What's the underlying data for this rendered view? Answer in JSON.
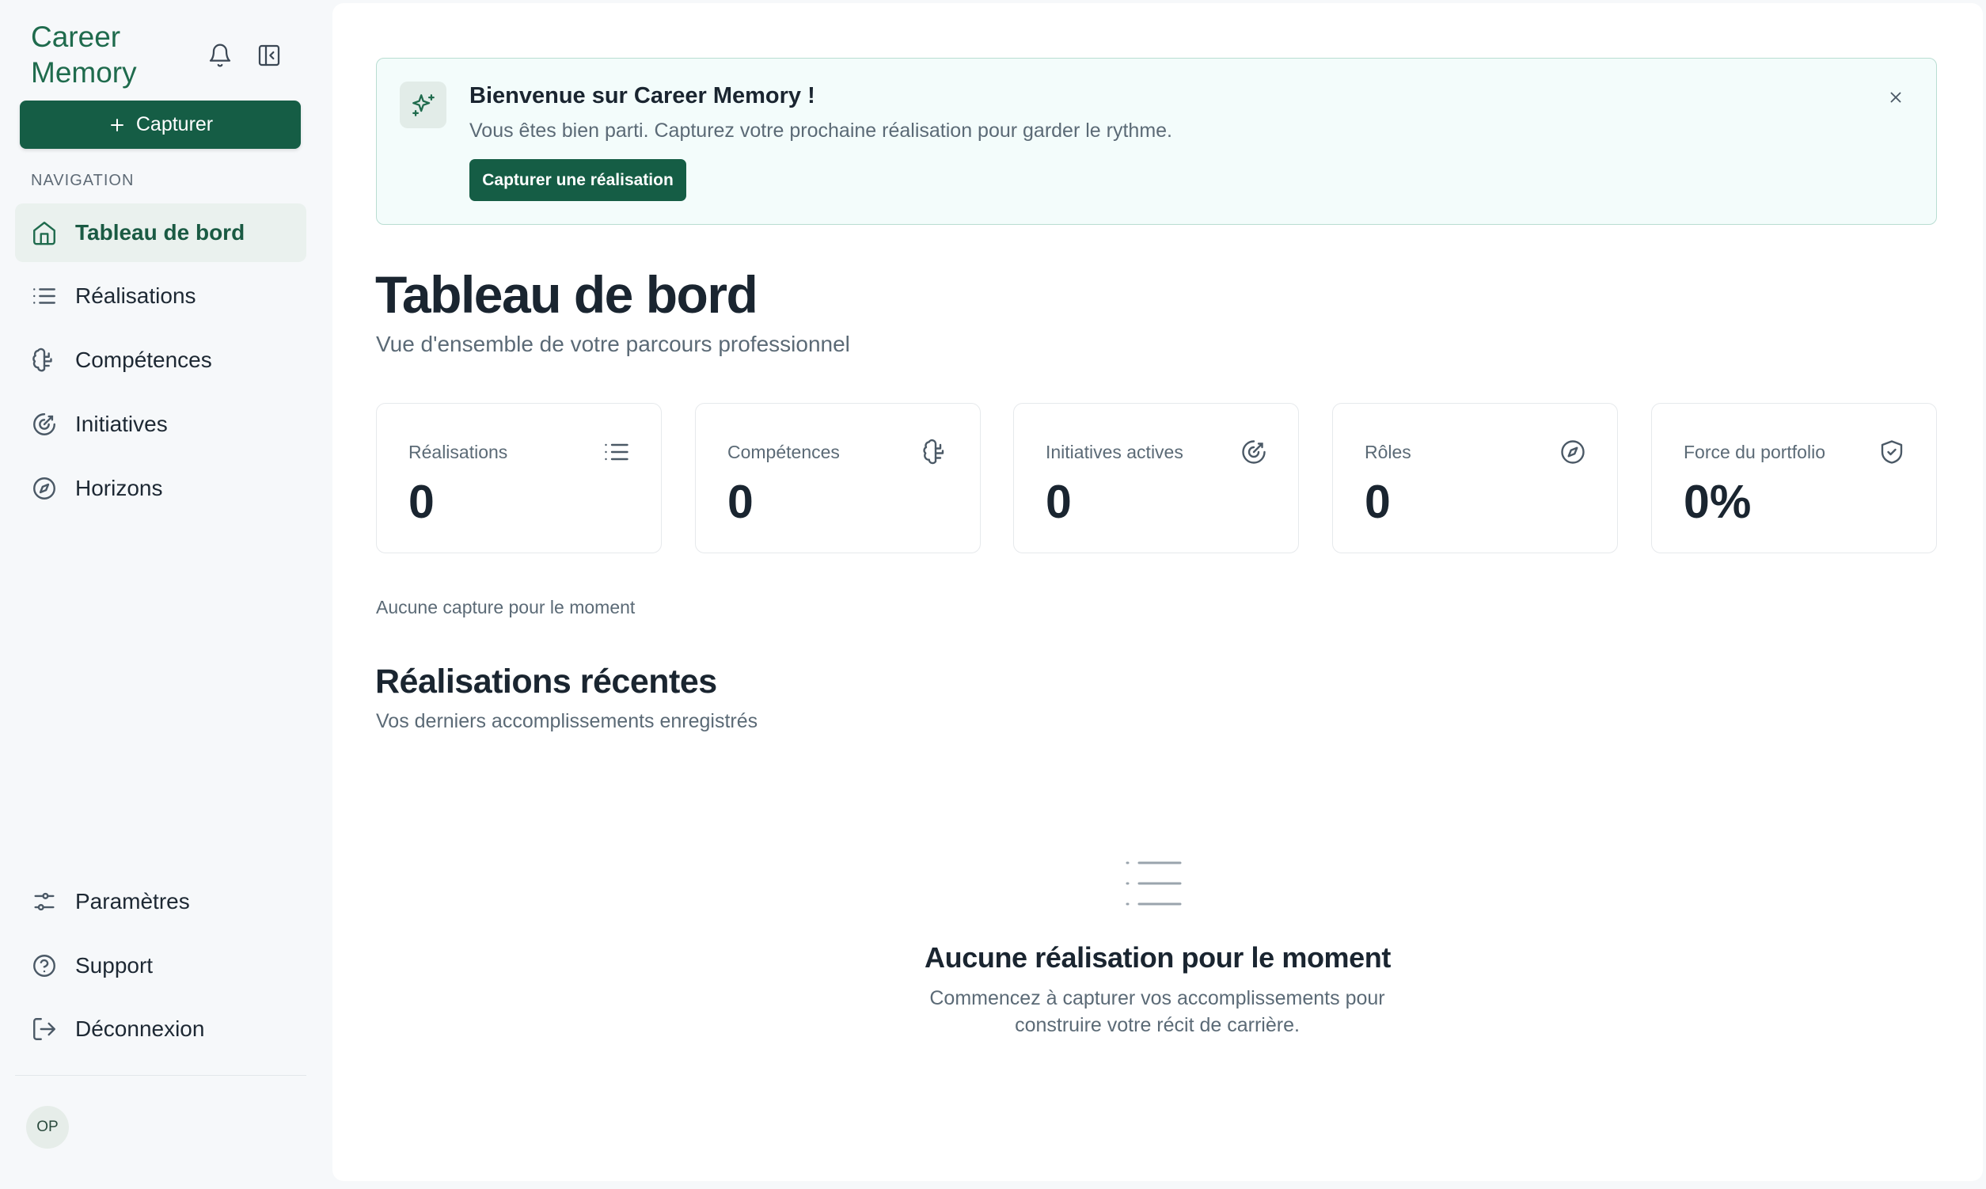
{
  "app": {
    "brand_line1": "Career",
    "brand_line2": "Memory",
    "accent_color": "#155d45"
  },
  "sidebar": {
    "capture_label": "Capturer",
    "nav_label": "NAVIGATION",
    "items": [
      {
        "label": "Tableau de bord",
        "icon": "home-icon",
        "active": true
      },
      {
        "label": "Réalisations",
        "icon": "list-icon"
      },
      {
        "label": "Compétences",
        "icon": "brain-icon"
      },
      {
        "label": "Initiatives",
        "icon": "target-icon"
      },
      {
        "label": "Horizons",
        "icon": "compass-icon"
      }
    ],
    "bottom_items": [
      {
        "label": "Paramètres",
        "icon": "sliders-icon"
      },
      {
        "label": "Support",
        "icon": "help-circle-icon"
      },
      {
        "label": "Déconnexion",
        "icon": "logout-icon"
      }
    ],
    "avatar_initials": "OP"
  },
  "banner": {
    "title": "Bienvenue sur Career Memory !",
    "text": "Vous êtes bien parti. Capturez votre prochaine réalisation pour garder le rythme.",
    "button_label": "Capturer une réalisation"
  },
  "page": {
    "title": "Tableau de bord",
    "subtitle": "Vue d'ensemble de votre parcours professionnel"
  },
  "stats": [
    {
      "label": "Réalisations",
      "value": "0",
      "icon": "list-icon"
    },
    {
      "label": "Compétences",
      "value": "0",
      "icon": "brain-icon"
    },
    {
      "label": "Initiatives actives",
      "value": "0",
      "icon": "target-icon"
    },
    {
      "label": "Rôles",
      "value": "0",
      "icon": "compass-icon"
    },
    {
      "label": "Force du portfolio",
      "value": "0%",
      "icon": "shield-check-icon"
    }
  ],
  "no_capture_text": "Aucune capture pour le moment",
  "recent": {
    "title": "Réalisations récentes",
    "subtitle": "Vos derniers accomplissements enregistrés",
    "empty_title": "Aucune réalisation pour le moment",
    "empty_text": "Commencez à capturer vos accomplissements pour construire votre récit de carrière."
  }
}
